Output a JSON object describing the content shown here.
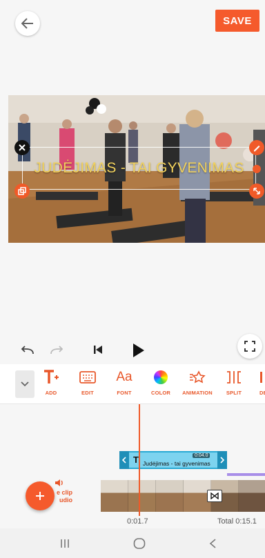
{
  "header": {
    "save_label": "SAVE"
  },
  "preview": {
    "overlay_text": "JUDĖJIMAS - TAI GYVENIMAS",
    "overlay_color": "#f2d25c"
  },
  "toolbar": {
    "items": [
      {
        "label": "ADD",
        "icon": "add-text-icon"
      },
      {
        "label": "EDIT",
        "icon": "keyboard-icon"
      },
      {
        "label": "FONT",
        "icon": "font-icon"
      },
      {
        "label": "COLOR",
        "icon": "color-wheel-icon"
      },
      {
        "label": "ANIMATION",
        "icon": "animation-icon"
      },
      {
        "label": "SPLIT",
        "icon": "split-icon"
      },
      {
        "label": "DE",
        "icon": "delete-icon"
      }
    ]
  },
  "timeline": {
    "text_clip": {
      "title": "Judėjimas - tai gyvenimas",
      "duration": "0:04.0"
    },
    "add_clip_label_1": "e clip",
    "add_clip_label_2": "udio",
    "current_time": "0:01.7",
    "total_time": "Total 0:15.1"
  },
  "colors": {
    "accent": "#f55a2c",
    "clip": "#7dd3ef",
    "audio": "#a88ee8"
  }
}
